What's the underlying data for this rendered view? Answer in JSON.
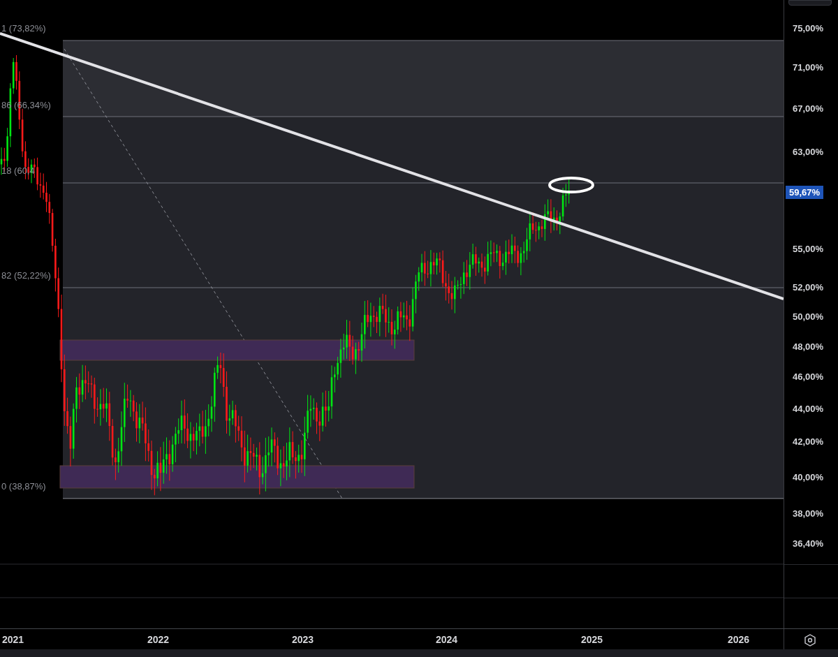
{
  "fib_levels": [
    {
      "label": "1 (73,82%)"
    },
    {
      "label": "86 (66,34%)"
    },
    {
      "label": "18 (60,4"
    },
    {
      "label": "82 (52,22%)"
    },
    {
      "label": "0 (38,87%)"
    }
  ],
  "price_axis": {
    "ticks": [
      "75,00%",
      "71,00%",
      "67,00%",
      "63,00%",
      "55,00%",
      "52,00%",
      "50,00%",
      "48,00%",
      "46,00%",
      "44,00%",
      "42,00%",
      "40,00%",
      "38,00%",
      "36,40%"
    ],
    "current_price": "59,67%"
  },
  "time_axis": {
    "years": [
      "2021",
      "2022",
      "2023",
      "2024",
      "2025",
      "2026"
    ]
  }
}
